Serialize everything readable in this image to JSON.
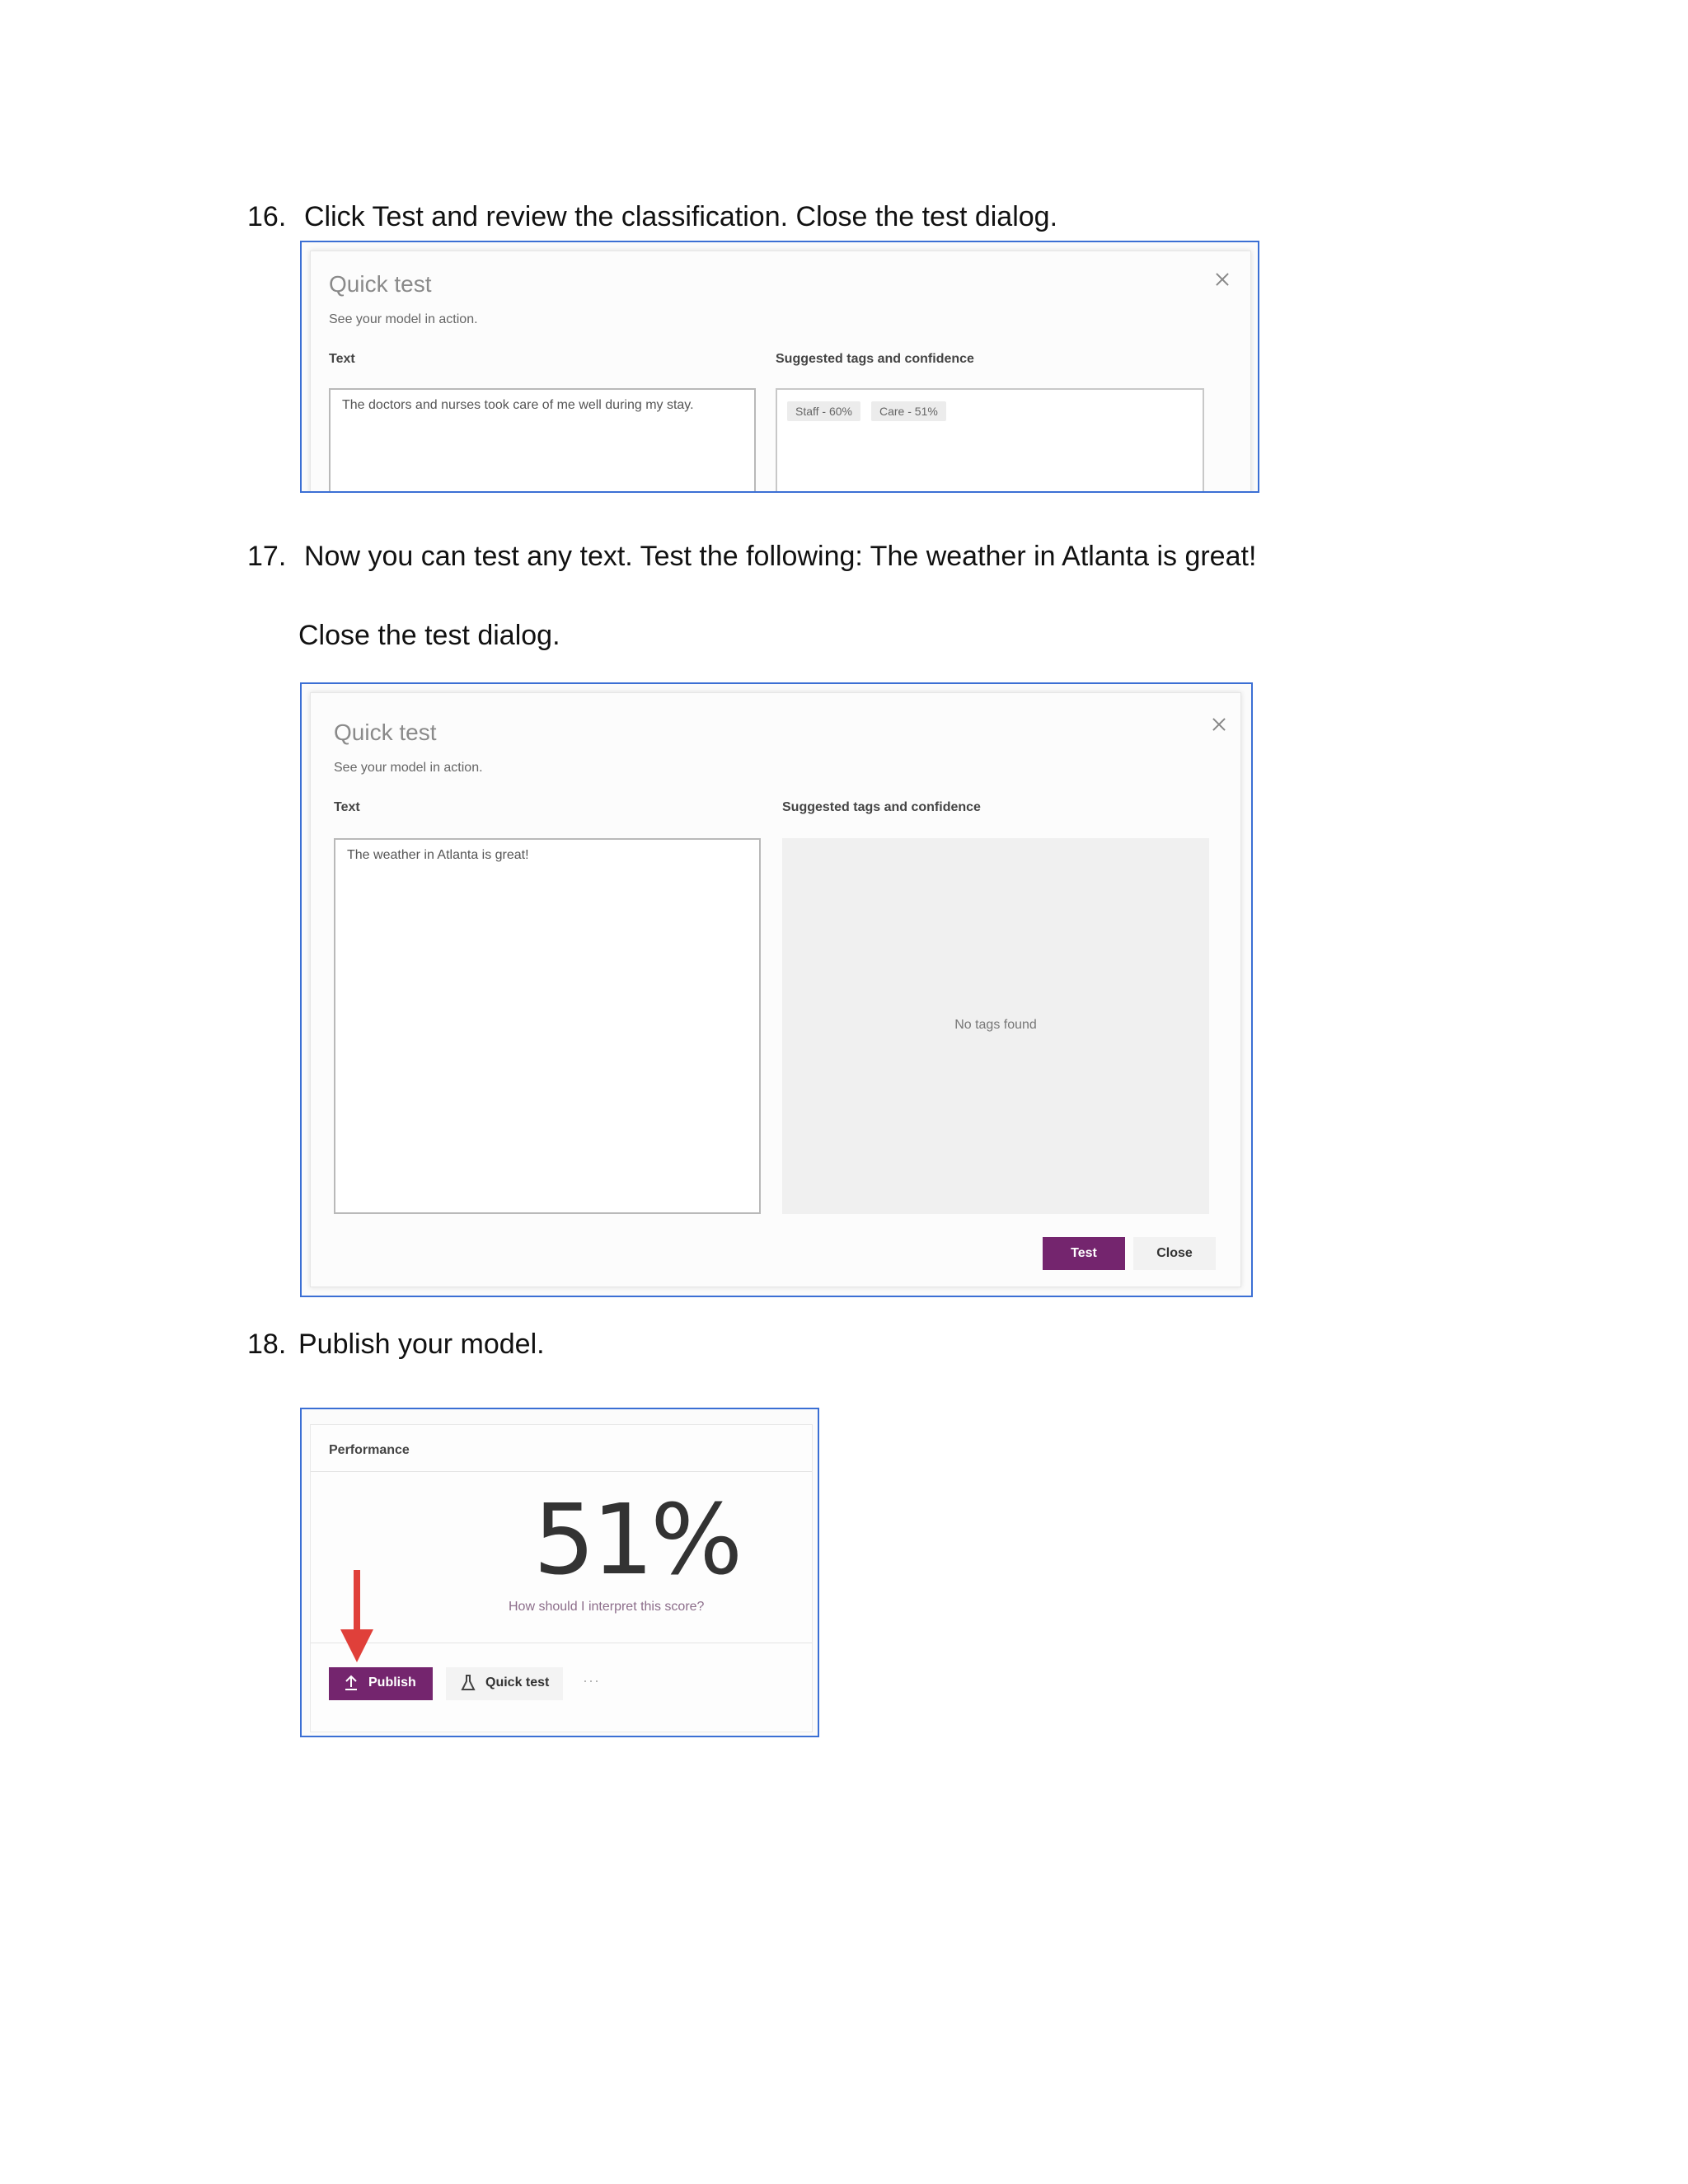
{
  "steps": [
    {
      "number": "16.",
      "text": "Click Test and review the classification.  Close the test dialog."
    },
    {
      "number": "17.",
      "text": "Now you can test any text.   Test the following:  The weather in Atlanta is great!",
      "followup": "Close the test dialog."
    },
    {
      "number": "18.",
      "text": "Publish your model."
    }
  ],
  "dialog1": {
    "title": "Quick test",
    "subtitle": "See your model in action.",
    "text_label": "Text",
    "text_value": "The doctors and nurses took care of me well during my stay.",
    "tags_label": "Suggested tags and confidence",
    "tags": [
      "Staff - 60%",
      "Care - 51%"
    ]
  },
  "dialog2": {
    "title": "Quick test",
    "subtitle": "See your model in action.",
    "text_label": "Text",
    "text_value": "The weather in Atlanta is great!",
    "tags_label": "Suggested tags and confidence",
    "empty_message": "No tags found",
    "test_button": "Test",
    "close_button": "Close"
  },
  "performance": {
    "title": "Performance",
    "score": "51%",
    "interpret_link": "How should I interpret this score?",
    "publish_button": "Publish",
    "quick_test_button": "Quick test",
    "more": "···"
  },
  "colors": {
    "accent": "#74256e",
    "screenshot_border": "#3b6fd4",
    "arrow": "#e0403a"
  }
}
